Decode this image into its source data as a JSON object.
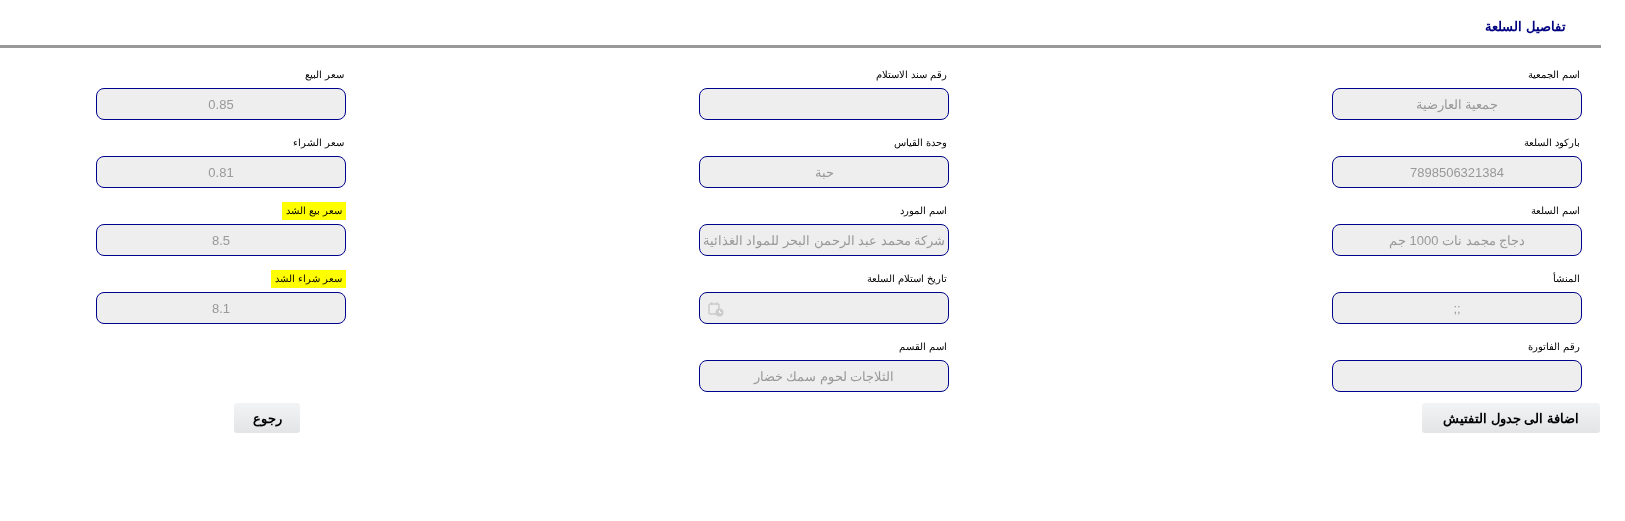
{
  "title": "تفاصيل السلعة",
  "columns": [
    {
      "fields": [
        {
          "label": "اسم الجمعية",
          "value": "جمعية العارضية",
          "kind": "text",
          "highlight": false
        },
        {
          "label": "باركود السلعة",
          "value": "7898506321384",
          "kind": "text",
          "highlight": false
        },
        {
          "label": "اسم السلعة",
          "value": "دجاج مجمد نات 1000 جم",
          "kind": "text",
          "highlight": false
        },
        {
          "label": "المنشأ",
          "value": ";;",
          "kind": "text",
          "highlight": false
        },
        {
          "label": "رقم الفاتورة",
          "kind": "text",
          "highlight": false
        }
      ]
    },
    {
      "fields": [
        {
          "label": "رقم سند الاستلام",
          "kind": "text",
          "highlight": false
        },
        {
          "label": "وحدة القياس",
          "value": "حبة",
          "kind": "text",
          "highlight": false
        },
        {
          "label": "اسم المورد",
          "value": "شركة محمد عبد الرحمن البحر للمواد الغذائية",
          "kind": "text",
          "highlight": false
        },
        {
          "label": "تاريخ استلام السلعة",
          "kind": "date",
          "highlight": false
        },
        {
          "label": "اسم القسم",
          "value": "الثلاجات لحوم سمك خضار",
          "kind": "text",
          "highlight": false
        }
      ]
    },
    {
      "fields": [
        {
          "label": "سعر البيع",
          "value": "0.85",
          "kind": "text",
          "highlight": false
        },
        {
          "label": "سعر الشراء",
          "value": "0.81",
          "kind": "text",
          "highlight": false
        },
        {
          "label": "سعر بيع الشد",
          "value": "8.5",
          "kind": "text",
          "highlight": true
        },
        {
          "label": "سعر شراء الشد",
          "value": "8.1",
          "kind": "text",
          "highlight": true
        }
      ]
    }
  ],
  "buttons": [
    "اضافة الى جدول التفتيش",
    "رجوع"
  ]
}
